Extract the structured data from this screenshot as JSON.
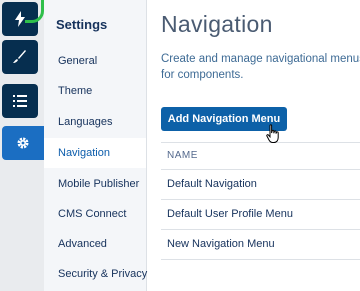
{
  "rail": {
    "icons": [
      "lightning-icon",
      "paintbrush-icon",
      "list-icon",
      "gear-icon"
    ],
    "accent": "#1b6ec2",
    "dark": "#062e4f"
  },
  "nav": {
    "title": "Settings",
    "items": [
      {
        "label": "General"
      },
      {
        "label": "Theme"
      },
      {
        "label": "Languages"
      },
      {
        "label": "Navigation",
        "selected": true
      },
      {
        "label": "Mobile Publisher"
      },
      {
        "label": "CMS Connect"
      },
      {
        "label": "Advanced"
      },
      {
        "label": "Security & Privacy"
      }
    ]
  },
  "main": {
    "title": "Navigation",
    "description": "Create and manage navigational menus for components.",
    "add_button_label": "Add Navigation Menu",
    "table": {
      "column_header": "NAME",
      "rows": [
        {
          "name": "Default Navigation"
        },
        {
          "name": "Default User Profile Menu"
        },
        {
          "name": "New Navigation Menu"
        }
      ]
    }
  },
  "colors": {
    "primary_button": "#0d61a8",
    "title_text": "#4a5b72"
  }
}
